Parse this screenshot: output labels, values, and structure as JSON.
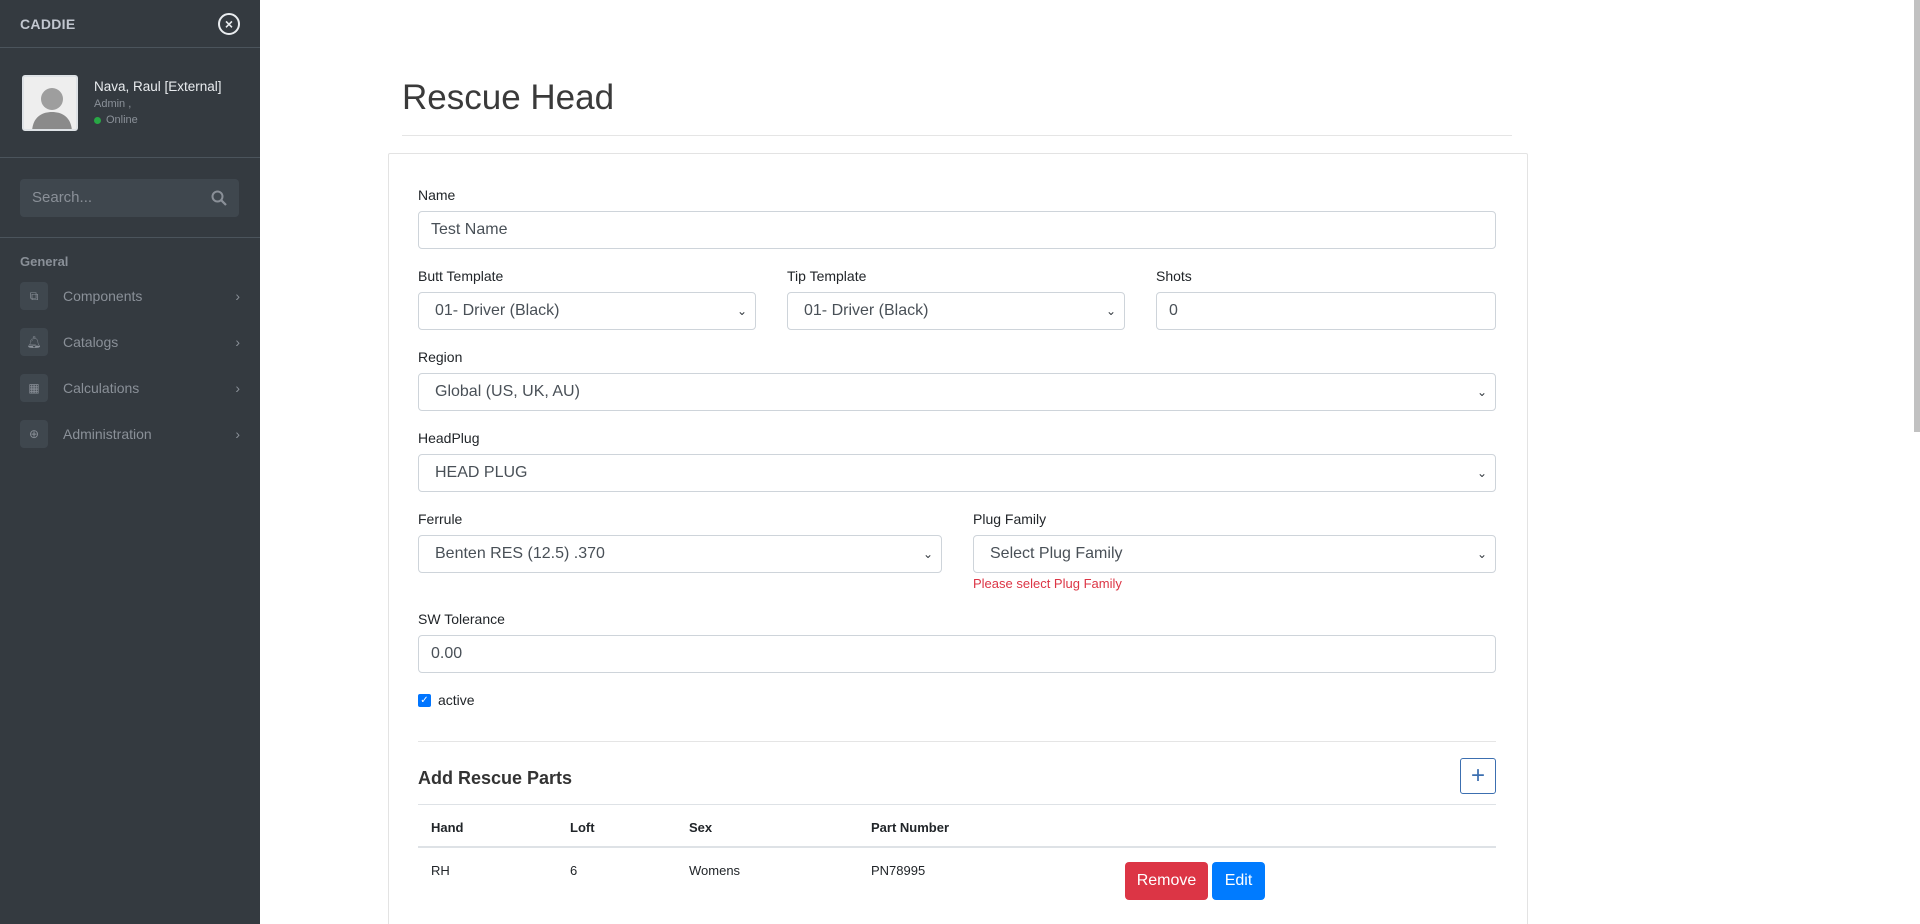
{
  "sidebar": {
    "brand": "CADDIE",
    "user": {
      "name": "Nava, Raul [External]",
      "role": "Admin ,",
      "status": "Online"
    },
    "search": {
      "placeholder": "Search..."
    },
    "section": "General",
    "items": [
      {
        "label": "Components",
        "icon": "components-icon"
      },
      {
        "label": "Catalogs",
        "icon": "bell-icon"
      },
      {
        "label": "Calculations",
        "icon": "calculator-icon"
      },
      {
        "label": "Administration",
        "icon": "globe-icon"
      }
    ]
  },
  "page": {
    "title": "Rescue Head"
  },
  "form": {
    "name": {
      "label": "Name",
      "value": "Test Name"
    },
    "butt_template": {
      "label": "Butt Template",
      "value": "01- Driver (Black)"
    },
    "tip_template": {
      "label": "Tip Template",
      "value": "01- Driver (Black)"
    },
    "shots": {
      "label": "Shots",
      "value": "0"
    },
    "region": {
      "label": "Region",
      "value": "Global (US, UK, AU)"
    },
    "headplug": {
      "label": "HeadPlug",
      "value": "HEAD PLUG"
    },
    "ferrule": {
      "label": "Ferrule",
      "value": "Benten RES (12.5) .370"
    },
    "plug_family": {
      "label": "Plug Family",
      "value": "Select Plug Family",
      "error": "Please select Plug Family"
    },
    "sw_tolerance": {
      "label": "SW Tolerance",
      "value": "0.00"
    },
    "active": {
      "label": "active",
      "checked": true
    }
  },
  "parts": {
    "title": "Add Rescue Parts",
    "add_label": "+",
    "columns": [
      "Hand",
      "Loft",
      "Sex",
      "Part Number"
    ],
    "rows": [
      {
        "hand": "RH",
        "loft": "6",
        "sex": "Womens",
        "part_number": "PN78995"
      }
    ],
    "remove_label": "Remove",
    "edit_label": "Edit"
  }
}
